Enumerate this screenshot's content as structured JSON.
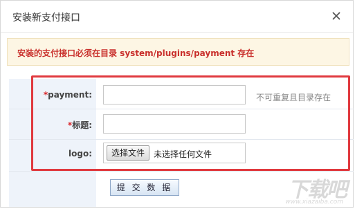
{
  "dialog": {
    "title": "安装新支付接口",
    "close_icon": "close-icon"
  },
  "notice": {
    "text": "安装的支付接口必须在目录 system/plugins/payment 存在",
    "color": "#c9302c",
    "background": "#fdf6e4"
  },
  "form": {
    "payment": {
      "required_mark": "*",
      "label": "payment:",
      "value": "",
      "hint": "不可重复且目录存在"
    },
    "title_field": {
      "required_mark": "*",
      "label": "标题:",
      "value": ""
    },
    "logo": {
      "label": "logo:",
      "button_label": "选择文件",
      "status": "未选择任何文件"
    },
    "submit_label": "提 交 数 据"
  },
  "highlight_color": "#e0393e",
  "watermark": {
    "main": "下载吧",
    "sub": "www.xiazaiba.com"
  }
}
